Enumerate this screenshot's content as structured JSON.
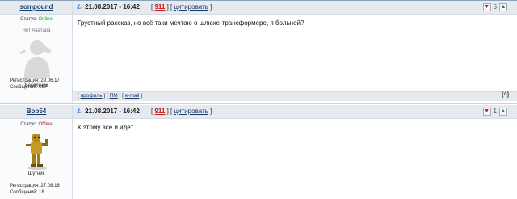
{
  "posts": [
    {
      "nick": "sompound",
      "status_label": "Статус:",
      "status": "Online",
      "avatar_text": "Нет Аватара",
      "rank": "Весельчак",
      "reg": "Регистрация: 29.06.17",
      "msgs": "Сообщений: 197",
      "date": "21.08.2017 - 16:42",
      "num": "911",
      "quote": "цитировать",
      "rating": "5",
      "text": "Грустный рассказ, но всё таки мечтаю о шлюхе-трансформере, я больной?",
      "links": {
        "profile": "профиль",
        "pm": "ПМ",
        "email": "e-mail"
      },
      "up": "[^]"
    },
    {
      "nick": "Bob54",
      "status_label": "Статус:",
      "status": "Offline",
      "rank": "Шутник",
      "reg": "Регистрация: 27.08.16",
      "msgs": "Сообщений: 18",
      "date": "21.08.2017 - 16:42",
      "num": "911",
      "quote": "цитировать",
      "rating": "1",
      "text": "К этому всё и идёт..."
    }
  ],
  "icons": {
    "pin": "pin-icon",
    "minus": "rating-minus-icon",
    "plus": "rating-plus-icon",
    "avatar": "no-avatar-silhouette",
    "avatar2": "robot-avatar"
  }
}
